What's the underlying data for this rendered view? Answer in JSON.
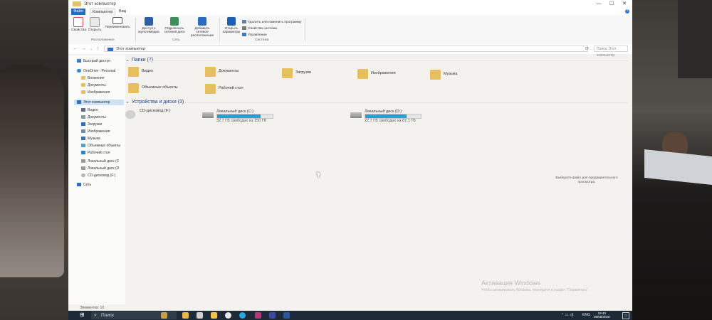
{
  "window": {
    "title": "Этот компьютер",
    "controls": [
      "—",
      "☐",
      "✕"
    ],
    "help": "?"
  },
  "tabs": [
    {
      "label": "Файл"
    },
    {
      "label": "Компьютер",
      "active": true
    },
    {
      "label": "Вид"
    }
  ],
  "ribbon": {
    "buttons": [
      {
        "label": "Свойства",
        "icon": "properties-icon"
      },
      {
        "label": "Открыть",
        "icon": "open-icon"
      },
      {
        "label": "Переименовать",
        "icon": "rename-icon"
      },
      {
        "label": "Доступ к мультимедиа",
        "icon": "media-access-icon"
      },
      {
        "label": "Подключить сетевой диск",
        "icon": "map-drive-icon"
      },
      {
        "label": "Добавить сетевое расположение",
        "icon": "network-location-icon"
      },
      {
        "label": "Открыть параметры",
        "icon": "settings-icon"
      }
    ],
    "small_buttons": [
      {
        "label": "Удалить или изменить программу"
      },
      {
        "label": "Свойства системы"
      },
      {
        "label": "Управление"
      }
    ],
    "groups": [
      {
        "label": "Расположение"
      },
      {
        "label": "Сеть"
      },
      {
        "label": "Система"
      }
    ],
    "colors": {
      "accent": "#1f6fc4"
    }
  },
  "address": {
    "path": "Этот компьютер",
    "search_placeholder": "Поиск: Этот компьютер"
  },
  "sidebar": {
    "items": [
      {
        "label": "Быстрый доступ",
        "icon": "star-icon",
        "level": 0
      },
      {
        "label": "OneDrive - Personal",
        "icon": "cloud-icon",
        "level": 0
      },
      {
        "label": "Вложения",
        "icon": "folder-icon",
        "level": 1
      },
      {
        "label": "Документы",
        "icon": "folder-icon",
        "level": 1
      },
      {
        "label": "Изображения",
        "icon": "folder-icon",
        "level": 1
      },
      {
        "label": "Этот компьютер",
        "icon": "computer-icon",
        "level": 0,
        "selected": true
      },
      {
        "label": "Видео",
        "icon": "video-icon",
        "level": 1
      },
      {
        "label": "Документы",
        "icon": "documents-icon",
        "level": 1
      },
      {
        "label": "Загрузки",
        "icon": "download-icon",
        "level": 1
      },
      {
        "label": "Изображения",
        "icon": "pictures-icon",
        "level": 1
      },
      {
        "label": "Музыка",
        "icon": "music-icon",
        "level": 1
      },
      {
        "label": "Объемные объекты",
        "icon": "3d-objects-icon",
        "level": 1
      },
      {
        "label": "Рабочий стол",
        "icon": "desktop-icon",
        "level": 1
      },
      {
        "label": "Локальный диск (C",
        "icon": "drive-icon",
        "level": 1
      },
      {
        "label": "Локальный диск (D",
        "icon": "drive-icon",
        "level": 1
      },
      {
        "label": "CD-дисковод (F:)",
        "icon": "cd-icon",
        "level": 1
      },
      {
        "label": "Сеть",
        "icon": "network-icon",
        "level": 0
      }
    ]
  },
  "folders_section": {
    "title": "Папки (7)",
    "items": [
      {
        "label": "Видео",
        "icon": "video-folder-icon"
      },
      {
        "label": "Документы",
        "icon": "documents-folder-icon"
      },
      {
        "label": "Загрузки",
        "icon": "downloads-folder-icon"
      },
      {
        "label": "Изображения",
        "icon": "pictures-folder-icon"
      },
      {
        "label": "Музыка",
        "icon": "music-folder-icon"
      },
      {
        "label": "Объемные объекты",
        "icon": "3d-objects-folder-icon"
      },
      {
        "label": "Рабочий стол",
        "icon": "desktop-folder-icon"
      }
    ]
  },
  "drives_section": {
    "title": "Устройства и диски (3)",
    "items": [
      {
        "name": "CD-дисковод (F:)",
        "icon": "cd-drive-icon",
        "free": "",
        "used_fraction": null
      },
      {
        "name": "Локальный диск (C:)",
        "icon": "windows-drive-icon",
        "free": "32,7 ГБ свободно из 150 ГБ",
        "used_fraction": 0.78
      },
      {
        "name": "Локальный диск (D:)",
        "icon": "drive-icon",
        "free": "22,7 ГБ свободно из 87,1 ГБ",
        "used_fraction": 0.74
      }
    ]
  },
  "preview_text": "Выберите файл для предварительного просмотра.",
  "watermark": {
    "line1": "Активация Windows",
    "line2": "Чтобы активировать Windows, перейдите в раздел \"Параметры\"."
  },
  "status": {
    "items_count": "Элементов: 10"
  },
  "taskbar": {
    "search": "Поиск",
    "apps": [
      {
        "icon": "explorer-icon",
        "color": "#e8b84a"
      },
      {
        "icon": "mail-icon",
        "color": "#cfcfcf"
      },
      {
        "icon": "folder-icon",
        "color": "#f0c44c"
      },
      {
        "icon": "chrome-icon",
        "color": "#e8e8e8"
      },
      {
        "icon": "telegram-icon",
        "color": "#2aa6de"
      },
      {
        "icon": "app-icon",
        "color": "#b23a7a"
      },
      {
        "icon": "calculator-icon",
        "color": "#3b4a9c"
      },
      {
        "icon": "word-icon",
        "color": "#2b579a"
      }
    ],
    "language": "ENG",
    "time": "19:40",
    "date": "08/08/2020"
  }
}
